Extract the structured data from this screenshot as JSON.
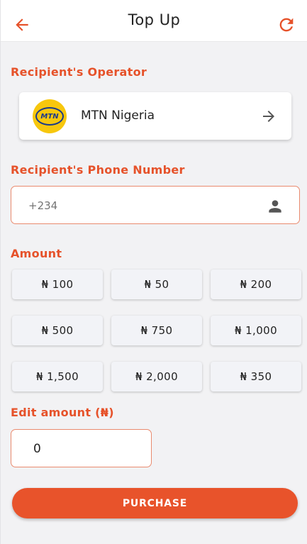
{
  "header": {
    "title": "Top Up",
    "back_icon": "arrow-left-icon",
    "refresh_icon": "refresh-icon"
  },
  "operator_section": {
    "label": "Recipient's Operator",
    "operator_name": "MTN Nigeria",
    "logo_text": "MTN",
    "arrow_icon": "arrow-right-icon"
  },
  "phone_section": {
    "label": "Recipient's Phone Number",
    "placeholder": "+234",
    "value": "",
    "contact_icon": "person-icon"
  },
  "amount_section": {
    "label": "Amount",
    "options": [
      "₦ 100",
      "₦ 50",
      "₦ 200",
      "₦ 500",
      "₦ 750",
      "₦ 1,000",
      "₦ 1,500",
      "₦ 2,000",
      "₦ 350"
    ]
  },
  "edit_amount": {
    "label": "Edit amount (₦)",
    "value": "0"
  },
  "purchase": {
    "label": "PURCHASE"
  },
  "colors": {
    "accent": "#e8532b",
    "label": "#e6522a",
    "background": "#f2f2f4"
  }
}
